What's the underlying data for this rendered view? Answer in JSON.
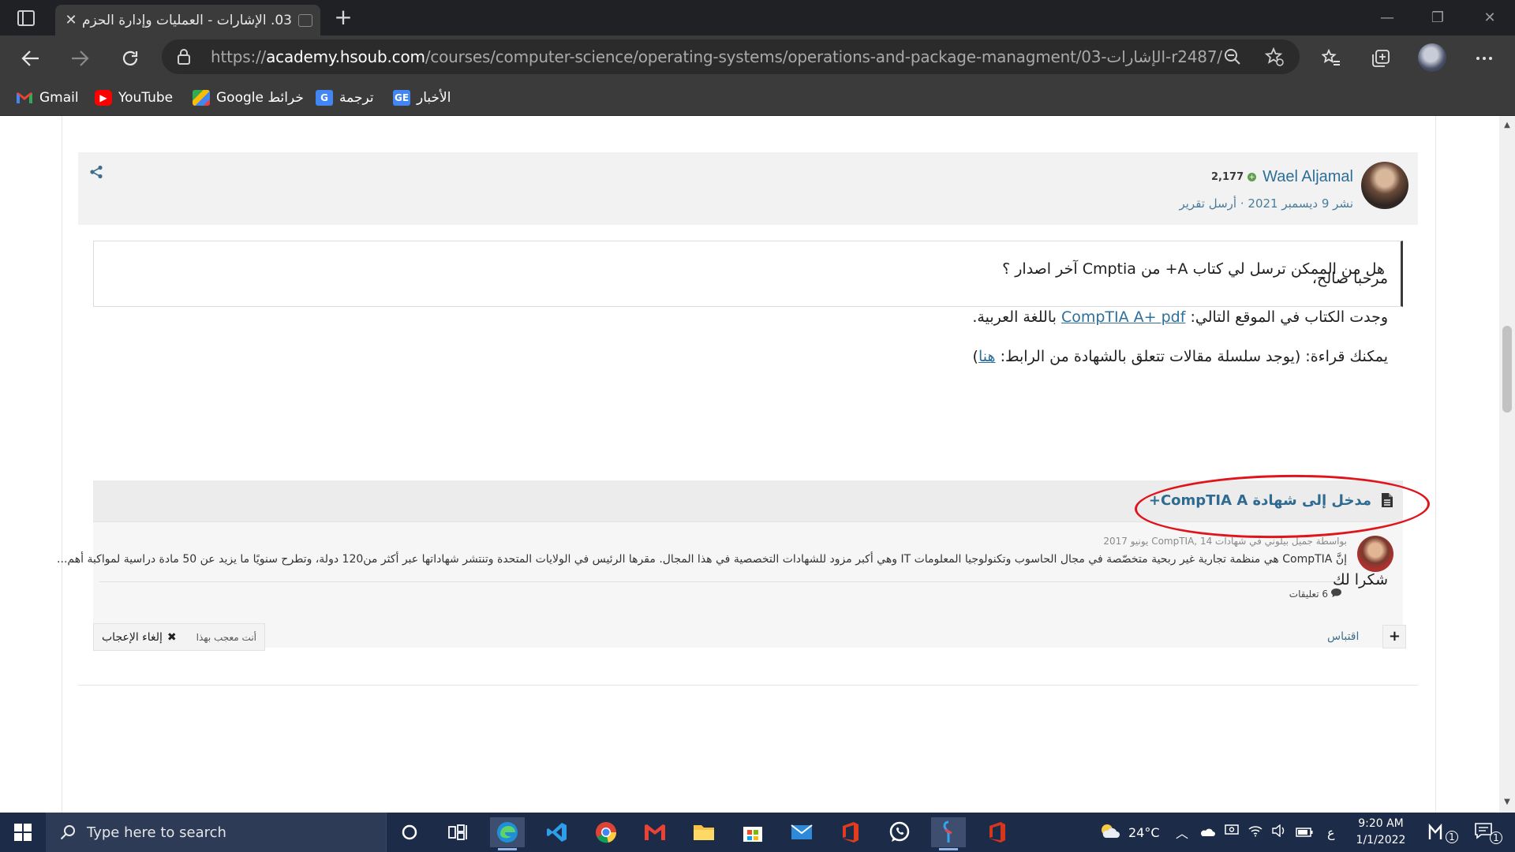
{
  "browser": {
    "tab_title": "03. الإشارات - العمليات وإدارة الحزم",
    "url_prefix": "https://",
    "url_host": "academy.hsoub.com",
    "url_path": "/courses/computer-science/operating-systems/operations-and-package-managment/03-الإشارات-r2487/",
    "bookmarks": [
      {
        "label": "Gmail",
        "icon": "gmail-icon",
        "color": "#ea4335"
      },
      {
        "label": "YouTube",
        "icon": "youtube-icon",
        "color": "#ff0000"
      },
      {
        "label": "Google خرائط",
        "icon": "maps-icon",
        "color": "#34a853"
      },
      {
        "label": "ترجمة",
        "icon": "translate-icon",
        "color": "#4285f4"
      },
      {
        "label": "الأخبار",
        "icon": "news-icon",
        "color": "#4285f4"
      }
    ]
  },
  "post": {
    "author_name": "Wael Aljamal",
    "reputation": "2,177",
    "meta": "نشر 9 ديسمبر 2021",
    "report_link": "أرسل تقرير",
    "quote_text": "هل من الممكن ترسل لي كتاب A+ من Cmptia آخر اصدار ؟",
    "greeting": "مرحبا صالح،",
    "p1_before": "وجدت الكتاب في الموقع التالي:",
    "p1_link": "CompTIA A+ pdf",
    "p1_after": "باللغة العربية.",
    "p2_before": "يمكنك قراءة: (يوجد سلسلة مقالات تتعلق بالشهادة من الرابط:",
    "p2_link": "هنا",
    "p2_after": ")",
    "thanks": "شكرا لك"
  },
  "embed": {
    "title": "مدخل إلى شهادة CompTIA A+",
    "byline": "بواسطة جميل بيلوني في شهادات CompTIA, 14 يونيو 2017",
    "excerpt": "إنَّ CompTIA هي منظمة تجارية غير ربحية متخصّصة في مجال الحاسوب وتكنولوجيا المعلومات IT وهي أكبر مزود للشهادات التخصصية في هذا المجال. مقرها الرئيس في الولايات المتحدة وتنتشر شهاداتها عبر أكثر من120 دولة، وتطرح سنويًا ما يزيد عن 50 مادة دراسية لمواكبة أهم...",
    "comments": "6 تعليقات"
  },
  "actions": {
    "liked_text": "أنت معجب بهذا",
    "unlike_label": "إلغاء الإعجاب",
    "quote_label": "اقتباس",
    "plus": "+"
  },
  "taskbar": {
    "search_placeholder": "Type here to search",
    "temperature": "24°C",
    "language": "ع",
    "time": "9:20 AM",
    "date": "1/1/2022",
    "notification_count": "1"
  },
  "colors": {
    "chrome_dark": "#202124",
    "chrome_toolbar": "#3b3b3b",
    "link_blue": "#2d6f9a",
    "annotation_red": "#e0141b",
    "taskbar": "#1c2b47"
  }
}
